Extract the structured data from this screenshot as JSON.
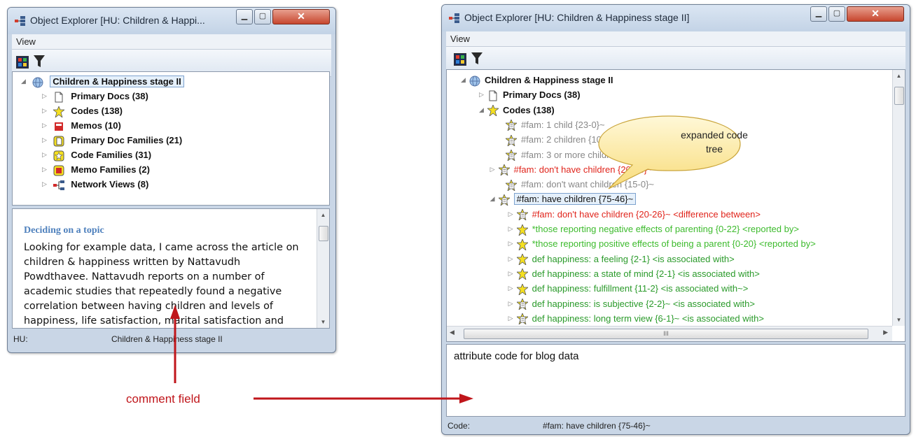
{
  "left_window": {
    "title": "Object Explorer  [HU: Children & Happi...",
    "menu": "View",
    "tree": [
      {
        "label": "Children & Happiness stage II",
        "arrow": "◢",
        "icon": "hu-globe-icon"
      },
      {
        "label": "Primary Docs (38)",
        "arrow": "▷",
        "icon": "document-icon"
      },
      {
        "label": "Codes (138)",
        "arrow": "▷",
        "icon": "code-icon"
      },
      {
        "label": "Memos (10)",
        "arrow": "▷",
        "icon": "memo-icon"
      },
      {
        "label": "Primary Doc Families (21)",
        "arrow": "▷",
        "icon": "doc-family-icon"
      },
      {
        "label": "Code Families (31)",
        "arrow": "▷",
        "icon": "code-family-icon"
      },
      {
        "label": "Memo Families (2)",
        "arrow": "▷",
        "icon": "memo-family-icon"
      },
      {
        "label": "Network Views (8)",
        "arrow": "▷",
        "icon": "network-icon"
      }
    ],
    "comment_heading": "Deciding on a topic",
    "comment_body": "Looking for example data, I came across the article on children & happiness written by Nattavudh Powdthavee. Nattavudh reports on a number of academic studies that repeatedly found a negative correlation between having children and levels of happiness, life satisfaction, marital satisfaction and mental well-being.",
    "status_label": "HU:",
    "status_value": "Children & Happiness stage II"
  },
  "right_window": {
    "title": "Object Explorer  [HU: Children & Happiness stage II]",
    "menu": "View",
    "tree": [
      {
        "label": "Children & Happiness stage II",
        "arrow": "◢",
        "style": "bold",
        "icon": "hu-globe-icon",
        "indent": 0
      },
      {
        "label": "Primary Docs (38)",
        "arrow": "▷",
        "style": "bold",
        "icon": "document-icon",
        "indent": 1
      },
      {
        "label": "Codes (138)",
        "arrow": "◢",
        "style": "bold",
        "icon": "code-icon",
        "indent": 1
      },
      {
        "label": "#fam: 1 child {23-0}~",
        "arrow": "",
        "style": "gray",
        "icon": "code-comment-icon",
        "indent": 2
      },
      {
        "label": "#fam: 2 children {10-0}~",
        "arrow": "",
        "style": "gray",
        "icon": "code-comment-icon",
        "indent": 2
      },
      {
        "label": "#fam: 3 or more children {9-0}~",
        "arrow": "",
        "style": "gray",
        "icon": "code-comment-icon",
        "indent": 2
      },
      {
        "label": "#fam: don't have children {20-26}~",
        "arrow": "▷",
        "style": "red",
        "icon": "code-comment-icon",
        "indent": 1.6
      },
      {
        "label": "#fam: don't want children {15-0}~",
        "arrow": "",
        "style": "gray",
        "icon": "code-comment-icon",
        "indent": 2
      },
      {
        "label": "#fam: have children {75-46}~",
        "arrow": "◢",
        "style": "selected",
        "icon": "code-comment-icon",
        "indent": 1.6
      },
      {
        "label": "#fam: don't have children {20-26}~ <difference between>",
        "arrow": "▷",
        "style": "red",
        "icon": "code-comment-icon",
        "indent": 2.6
      },
      {
        "label": "*those reporting negative effects of parenting {0-22} <reported by>",
        "arrow": "▷",
        "style": "green",
        "icon": "code-icon",
        "indent": 2.6
      },
      {
        "label": "*those reporting positive effects of being a parent {0-20} <reported by>",
        "arrow": "▷",
        "style": "green",
        "icon": "code-icon",
        "indent": 2.6
      },
      {
        "label": "def happiness: a feeling {2-1} <is associated with>",
        "arrow": "▷",
        "style": "dgreen",
        "icon": "code-icon",
        "indent": 2.6
      },
      {
        "label": "def happiness: a state of mind {2-1} <is associated with>",
        "arrow": "▷",
        "style": "dgreen",
        "icon": "code-icon",
        "indent": 2.6
      },
      {
        "label": "def happiness: fulfillment {11-2} <is associated with~>",
        "arrow": "▷",
        "style": "dgreen",
        "icon": "code-icon",
        "indent": 2.6
      },
      {
        "label": "def happiness: is subjective {2-2}~ <is associated with>",
        "arrow": "▷",
        "style": "dgreen",
        "icon": "code-comment-icon",
        "indent": 2.6
      },
      {
        "label": "def happiness: long term view {6-1}~ <is associated with>",
        "arrow": "▷",
        "style": "dgreen",
        "icon": "code-comment-icon",
        "indent": 2.6
      }
    ],
    "comment_text": "attribute code for blog data",
    "hscroll_grip": "III",
    "status_label": "Code:",
    "status_value": "#fam: have children {75-46}~"
  },
  "callout": {
    "text_line1": "expanded code",
    "text_line2": "tree"
  },
  "annotation": {
    "label": "comment field",
    "color": "#c0161b"
  },
  "colors": {
    "red_code": "#e0241b",
    "green_code": "#3dbb2d",
    "dark_green_code": "#2a9a2a",
    "gray_code": "#888888",
    "heading_blue": "#4f81bd"
  }
}
